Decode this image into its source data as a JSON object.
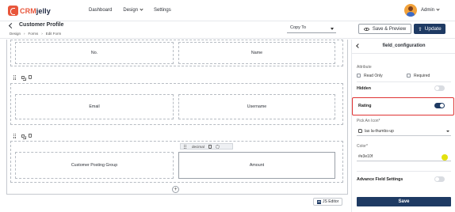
{
  "brand": {
    "name_part1": "CRM",
    "name_part2": "jelly"
  },
  "nav": {
    "dashboard": "Dashboard",
    "design": "Design",
    "settings": "Settings"
  },
  "user": {
    "name": "Admin"
  },
  "header": {
    "title": "Customer Profile",
    "breadcrumb": [
      "Design",
      "Forms",
      "Edit Form"
    ],
    "copy_to": "Copy To",
    "save_preview": "Save & Preview",
    "update": "Update"
  },
  "form": {
    "rows": [
      {
        "fields": [
          "No.",
          "Name"
        ]
      },
      {
        "fields": [
          "Email",
          "Username"
        ]
      },
      {
        "fields": [
          "Customer Posting Group",
          "Amount"
        ]
      }
    ],
    "selected_field_type": "decimal",
    "js_editor": "JS Editor"
  },
  "panel": {
    "title": "field_configuration",
    "attribute_label": "Attribute",
    "read_only": "Read Only",
    "required": "Required",
    "hidden_label": "Hidden",
    "hidden_on": false,
    "rating_label": "Rating",
    "rating_on": true,
    "pick_icon_label": "Pick An Icon*",
    "pick_icon_value": "las la-thumbs-up",
    "color_label": "Color*",
    "color_value": "#e3e10f",
    "color_swatch": "#e3e10f",
    "advance_label": "Advance Field Settings",
    "advance_on": false,
    "save": "Save"
  },
  "colors": {
    "brand_orange": "#e8563b",
    "primary_navy": "#1e3a63",
    "highlight_red": "#e03434"
  }
}
